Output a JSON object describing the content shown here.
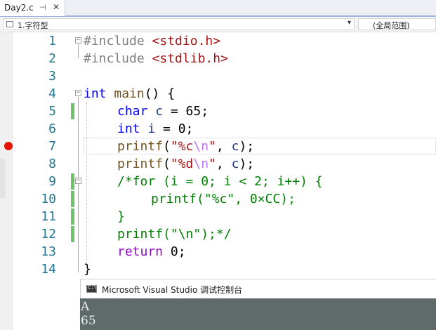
{
  "tab": {
    "title": "Day2.c",
    "pin_icon": "pin-icon",
    "close_icon": "close-icon"
  },
  "navbar": {
    "left_value": "1.字符型",
    "right_value": "(全局范围)"
  },
  "editor": {
    "line_numbers": [
      "1",
      "2",
      "3",
      "4",
      "5",
      "6",
      "7",
      "8",
      "9",
      "10",
      "11",
      "12",
      "13",
      "14"
    ],
    "lines": {
      "l1": {
        "pre": "#include ",
        "hdr": "<stdio.h>"
      },
      "l2": {
        "pre": "#include ",
        "hdr": "<stdlib.h>"
      },
      "l4": {
        "kw": "int",
        "fn": "main",
        "rest": "() {"
      },
      "l5": {
        "kw": "char",
        "var": "c",
        "rest": " = 65;"
      },
      "l6": {
        "kw": "int",
        "var": "i",
        "rest": " = 0;"
      },
      "l7": {
        "fn": "printf",
        "p1": "(",
        "s1": "\"%c",
        "esc": "\\n",
        "s2": "\"",
        "p2": ", ",
        "var": "c",
        "p3": ");"
      },
      "l8": {
        "fn": "printf",
        "p1": "(",
        "s1": "\"%d",
        "esc": "\\n",
        "s2": "\"",
        "p2": ", ",
        "var": "c",
        "p3": ");"
      },
      "l9": {
        "comment": "/*for (i = 0; i < 2; i++) {"
      },
      "l10": {
        "comment": "printf(\"%c\", 0×CC);"
      },
      "l11": {
        "comment": "}"
      },
      "l12": {
        "comment": "printf(\"\\n\");*/"
      },
      "l13": {
        "kw": "return",
        "rest": " 0;"
      },
      "l14": {
        "rest": "}"
      }
    },
    "breakpoint_line": 7,
    "current_line": 7
  },
  "console": {
    "title": "Microsoft Visual Studio 调试控制台",
    "icon_text": "C:\\",
    "output": [
      "A",
      "65"
    ]
  },
  "colors": {
    "keyword": "#0000ff",
    "preprocessor": "#808080",
    "string": "#a31515",
    "escape": "#b776fb",
    "comment": "#008000",
    "function": "#74531f",
    "variable": "#1f377f",
    "control": "#8f08c4",
    "line_number": "#237893",
    "breakpoint": "#e51400",
    "change_bar": "#6cc36b"
  }
}
